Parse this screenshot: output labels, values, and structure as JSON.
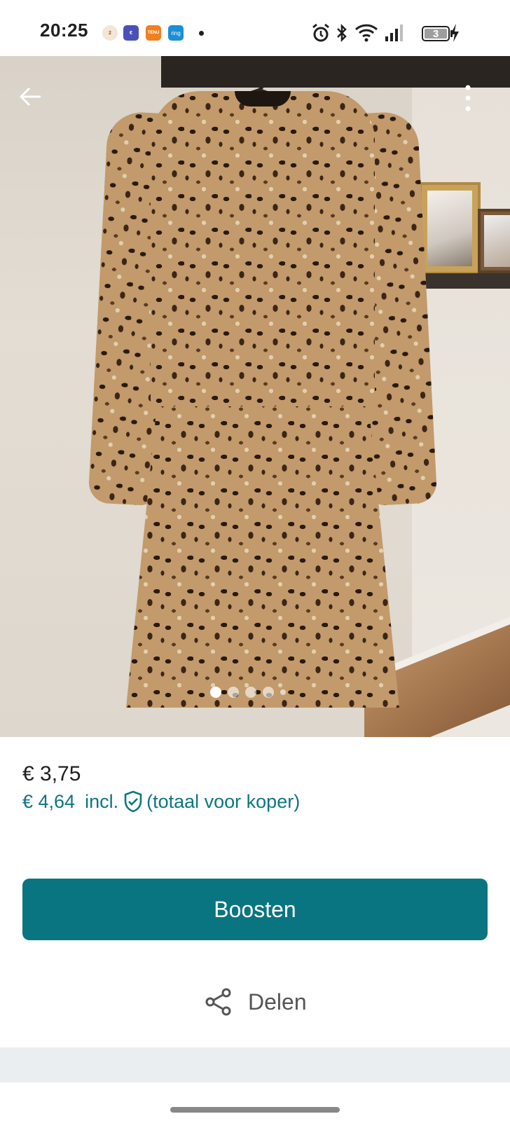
{
  "status_bar": {
    "time": "20:25",
    "battery_level": "3",
    "notification_icons": [
      "coin-notification-icon",
      "euro-app-icon",
      "tenu-app-icon",
      "ring-app-icon"
    ],
    "notif_labels": [
      "2",
      "€",
      "TENU",
      "ring"
    ]
  },
  "photo": {
    "image_count": 5,
    "active_index": 0,
    "description_icons": [
      "back-arrow-icon",
      "more-vert-icon"
    ]
  },
  "listing": {
    "price": "€ 3,75",
    "total_price": "€ 4,64",
    "incl_label": "incl.",
    "total_note": "(totaal voor koper)"
  },
  "actions": {
    "boost_label": "Boosten",
    "share_label": "Delen"
  },
  "colors": {
    "accent": "#087581",
    "accent_text": "#0d7680",
    "band": "#eaeef0"
  }
}
